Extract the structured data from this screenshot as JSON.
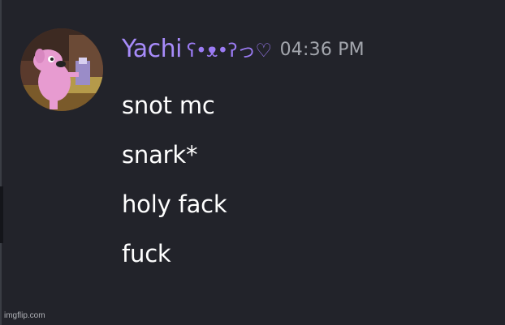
{
  "message_group": {
    "author": "Yachi",
    "author_decoration": "ʕ•ᴥ•ʔっ♡",
    "timestamp": "04:36 PM",
    "messages": [
      "snot mc",
      "snark*",
      "holy fack",
      "fuck"
    ]
  },
  "watermark": "imgflip.com",
  "colors": {
    "background": "#22232a",
    "username": "#a78bfa",
    "timestamp": "#a3a6ad",
    "message_text": "#ffffff"
  }
}
